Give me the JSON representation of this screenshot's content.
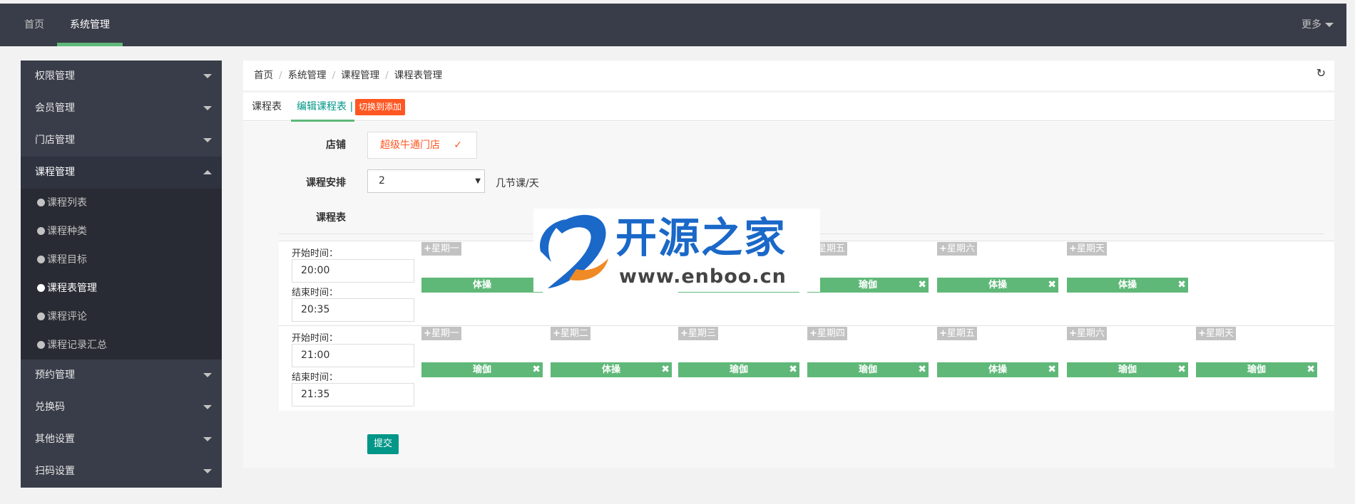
{
  "topnav": {
    "items": [
      "首页",
      "系统管理"
    ],
    "more": "更多"
  },
  "sidebar": {
    "groups_top": [
      "权限管理",
      "会员管理",
      "门店管理"
    ],
    "open_group": "课程管理",
    "sub_items": [
      "课程列表",
      "课程种类",
      "课程目标",
      "课程表管理",
      "课程评论",
      "课程记录汇总"
    ],
    "groups_bottom": [
      "预约管理",
      "兑换码",
      "其他设置",
      "扫码设置"
    ]
  },
  "breadcrumb": [
    "首页",
    "系统管理",
    "课程管理",
    "课程表管理"
  ],
  "tabs": {
    "tab1": "课程表",
    "tab2": "编辑课程表",
    "divider": "|",
    "switch": "切换到添加"
  },
  "form": {
    "store_label": "店铺",
    "store_value": "超级牛通门店",
    "arrange_label": "课程安排",
    "arrange_value": "2",
    "arrange_unit": "几节课/天",
    "table_label": "课程表",
    "start_label": "开始时间：",
    "end_label": "结束时间：",
    "submit": "提交"
  },
  "weekdays": [
    "星期一",
    "星期二",
    "星期三",
    "星期四",
    "星期五",
    "星期六",
    "星期天"
  ],
  "rows": [
    {
      "start": "20:00",
      "end": "20:35",
      "courses": [
        "体操",
        "",
        "",
        "体操",
        "瑜伽",
        "体操",
        "体操"
      ]
    },
    {
      "start": "21:00",
      "end": "21:35",
      "courses": [
        "瑜伽",
        "体操",
        "瑜伽",
        "瑜伽",
        "体操",
        "瑜伽",
        "瑜伽"
      ]
    }
  ],
  "watermark": {
    "cn": "开源之家",
    "en": "www.enboo.cn"
  },
  "colors": {
    "accent": "#5fb878",
    "teal": "#009688",
    "orange": "#ff5722",
    "dark": "#393d49"
  }
}
